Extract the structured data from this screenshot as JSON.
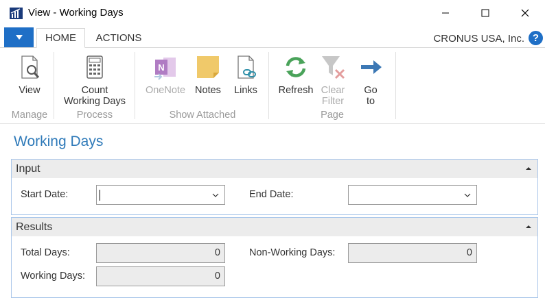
{
  "window": {
    "title": "View - Working Days",
    "minimize_icon": "minimize-icon",
    "maximize_icon": "maximize-icon",
    "close_icon": "close-icon"
  },
  "tabs": {
    "home": "HOME",
    "actions": "ACTIONS",
    "company": "CRONUS USA, Inc.",
    "help": "?"
  },
  "ribbon": {
    "view": "View",
    "count_line1": "Count",
    "count_line2": "Working Days",
    "onenote": "OneNote",
    "notes": "Notes",
    "links": "Links",
    "refresh": "Refresh",
    "clear_line1": "Clear",
    "clear_line2": "Filter",
    "goto_line1": "Go",
    "goto_line2": "to",
    "groups": {
      "manage": "Manage",
      "process": "Process",
      "show_attached": "Show Attached",
      "page": "Page"
    }
  },
  "page": {
    "title": "Working Days",
    "input": {
      "header": "Input",
      "start_date_label": "Start Date:",
      "start_date_value": "",
      "end_date_label": "End Date:",
      "end_date_value": ""
    },
    "results": {
      "header": "Results",
      "total_days_label": "Total Days:",
      "total_days_value": "0",
      "non_working_days_label": "Non-Working Days:",
      "non_working_days_value": "0",
      "working_days_label": "Working Days:",
      "working_days_value": "0"
    }
  },
  "colors": {
    "accent": "#1f6fc6",
    "title_blue": "#2f7ab9",
    "fasttab_border": "#a9c6ea",
    "header_gray": "#ececec"
  }
}
